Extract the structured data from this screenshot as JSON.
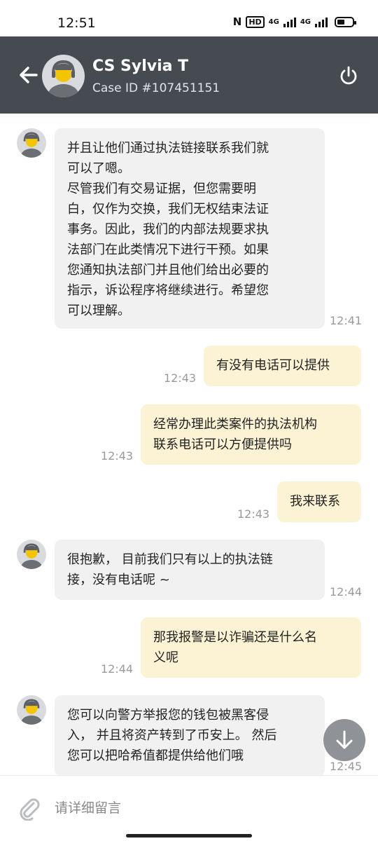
{
  "status": {
    "time": "12:51",
    "nfc": "N",
    "hd": "HD",
    "net1": "4G",
    "net2": "4G"
  },
  "header": {
    "name": "CS Sylvia T",
    "case_id": "Case ID #107451151"
  },
  "messages": [
    {
      "side": "in",
      "lines": [
        "并且让他们通过执法链接联系我们就",
        "可以了嗯。",
        "尽管我们有交易证据，但您需要明",
        "白，仅作为交换，我们无权结束法证",
        "事务。因此，我们的内部法规要求执",
        "法部门在此类情况下进行干预。如果",
        "您通知执法部门并且他们给出必要的",
        "指示，诉讼程序将继续进行。希望您",
        "可以理解。"
      ],
      "time": "12:41"
    },
    {
      "side": "out",
      "lines": [
        "有没有电话可以提供"
      ],
      "time": "12:43"
    },
    {
      "side": "out",
      "lines": [
        "经常办理此类案件的执法机构",
        "联系电话可以方便提供吗"
      ],
      "time": "12:43"
    },
    {
      "side": "out",
      "lines": [
        "我来联系"
      ],
      "time": "12:43"
    },
    {
      "side": "in",
      "lines": [
        "很抱歉， 目前我们只有以上的执法链",
        "接，没有电话呢 ~"
      ],
      "time": "12:44"
    },
    {
      "side": "out",
      "lines": [
        "那我报警是以诈骗还是什么名",
        "义呢"
      ],
      "time": "12:44"
    },
    {
      "side": "in",
      "lines": [
        "您可以向警方举报您的钱包被黑客侵",
        "入， 并且将资产转到了币安上。 然后",
        "您可以把哈希值都提供给他们哦"
      ],
      "time": "12:45"
    }
  ],
  "input": {
    "placeholder": "请详细留言"
  },
  "colors": {
    "header_bg": "#464b52",
    "incoming_bubble": "#f1f1f2",
    "outgoing_bubble": "#fbf3d3",
    "timestamp": "#9a9a9a"
  },
  "icons": {
    "back": "arrow-left-icon",
    "power": "power-icon",
    "attach": "paperclip-icon",
    "scroll": "arrow-down-icon"
  }
}
